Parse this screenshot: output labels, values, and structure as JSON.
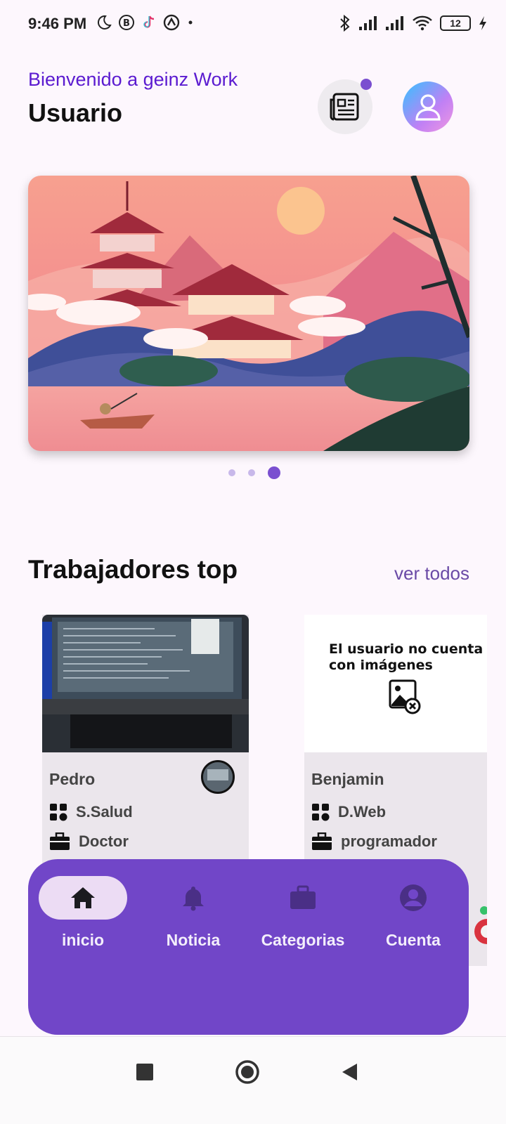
{
  "status_bar": {
    "time": "9:46 PM",
    "battery": "12",
    "left_icons": [
      "moon-icon",
      "b-badge-icon",
      "tiktok-icon",
      "circle-a-icon",
      "dot-icon"
    ],
    "right_icons": [
      "bluetooth-icon",
      "signal-icon",
      "signal-icon",
      "wifi-icon",
      "battery-icon",
      "charging-icon"
    ]
  },
  "header": {
    "welcome": "Bienvenido a geinz Work",
    "username": "Usuario",
    "news_icon": "newspaper-icon",
    "profile_icon": "user-icon"
  },
  "carousel": {
    "page_count": 3,
    "active_index": 2
  },
  "section": {
    "title": "Trabajadores top",
    "see_all": "ver todos"
  },
  "workers": [
    {
      "name": "Pedro",
      "category": "S.Salud",
      "profession": "Doctor",
      "has_image": true
    },
    {
      "name": "Benjamin",
      "category": "D.Web",
      "profession": "programador",
      "has_image": false,
      "no_image_text": "El usuario no cuenta con imágenes"
    }
  ],
  "bottom_nav": {
    "items": [
      {
        "label": "inicio",
        "icon": "home-icon",
        "active": true
      },
      {
        "label": "Noticia",
        "icon": "bell-icon",
        "active": false
      },
      {
        "label": "Categorias",
        "icon": "briefcase-icon",
        "active": false
      },
      {
        "label": "Cuenta",
        "icon": "account-icon",
        "active": false
      }
    ]
  },
  "colors": {
    "accent": "#7146c8",
    "welcome_text": "#5b1bd0",
    "background": "#fdf7fd",
    "active_pill": "#ecdcf4"
  }
}
